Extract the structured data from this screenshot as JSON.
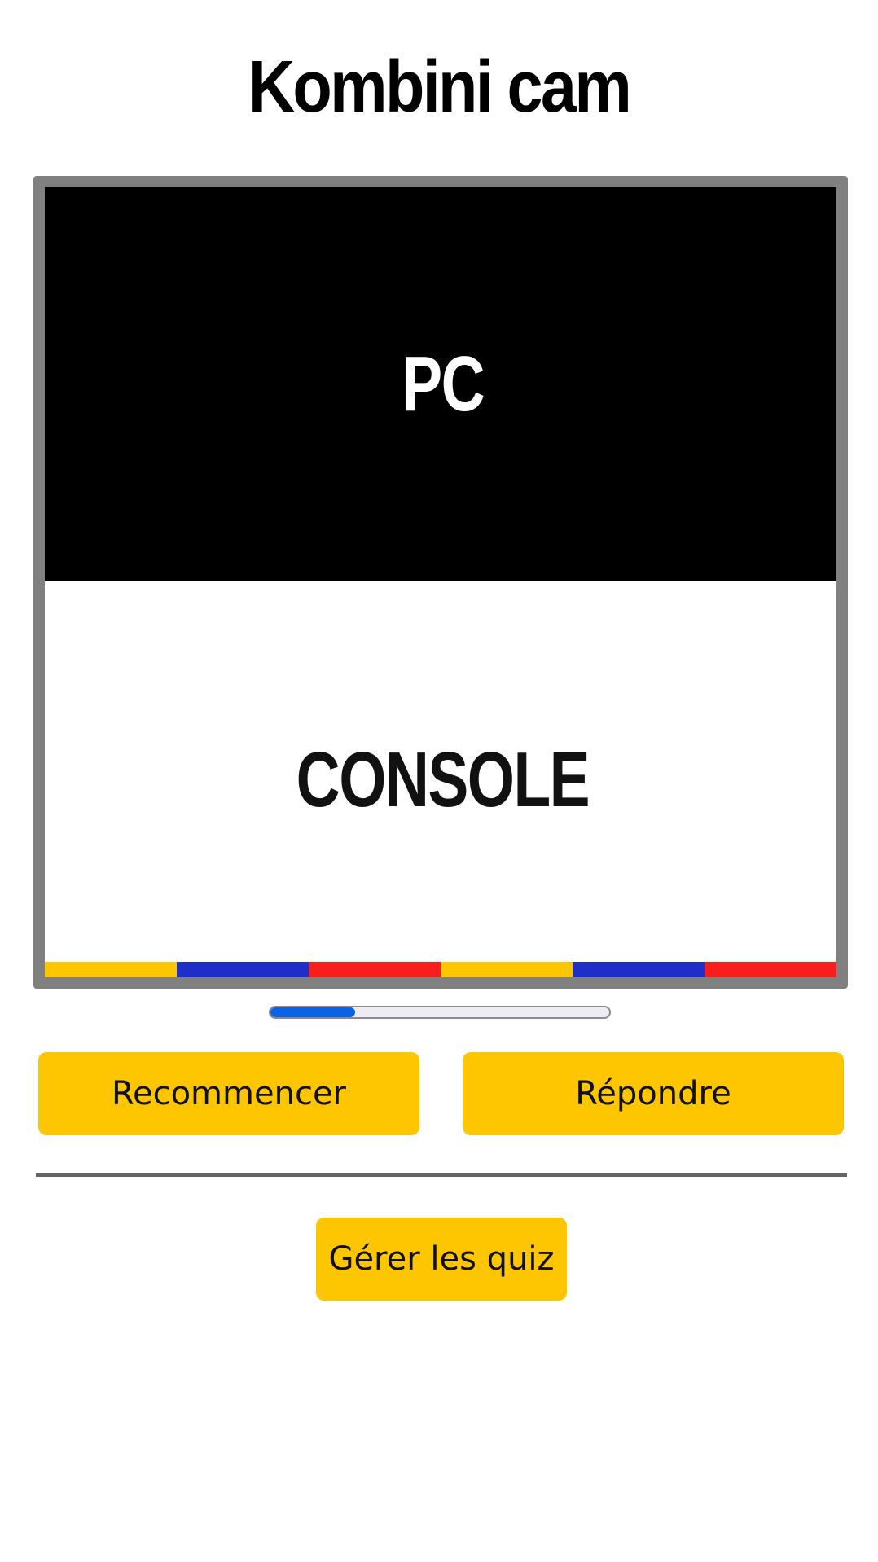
{
  "app": {
    "title": "Kombini cam"
  },
  "camera": {
    "option_top": "PC",
    "option_bottom": "CONSOLE",
    "strip_colors": [
      "#fdc600",
      "#1f2ec8",
      "#f81e1e",
      "#fdc600",
      "#1f2ec8",
      "#f81e1e"
    ]
  },
  "timer": {
    "progress": 0.25,
    "fill_color": "#0a62e6"
  },
  "actions": {
    "restart_label": "Recommencer",
    "answer_label": "Répondre",
    "manage_label": "Gérer les quiz"
  },
  "colors": {
    "accent": "#fdc600",
    "frame": "#808080"
  }
}
